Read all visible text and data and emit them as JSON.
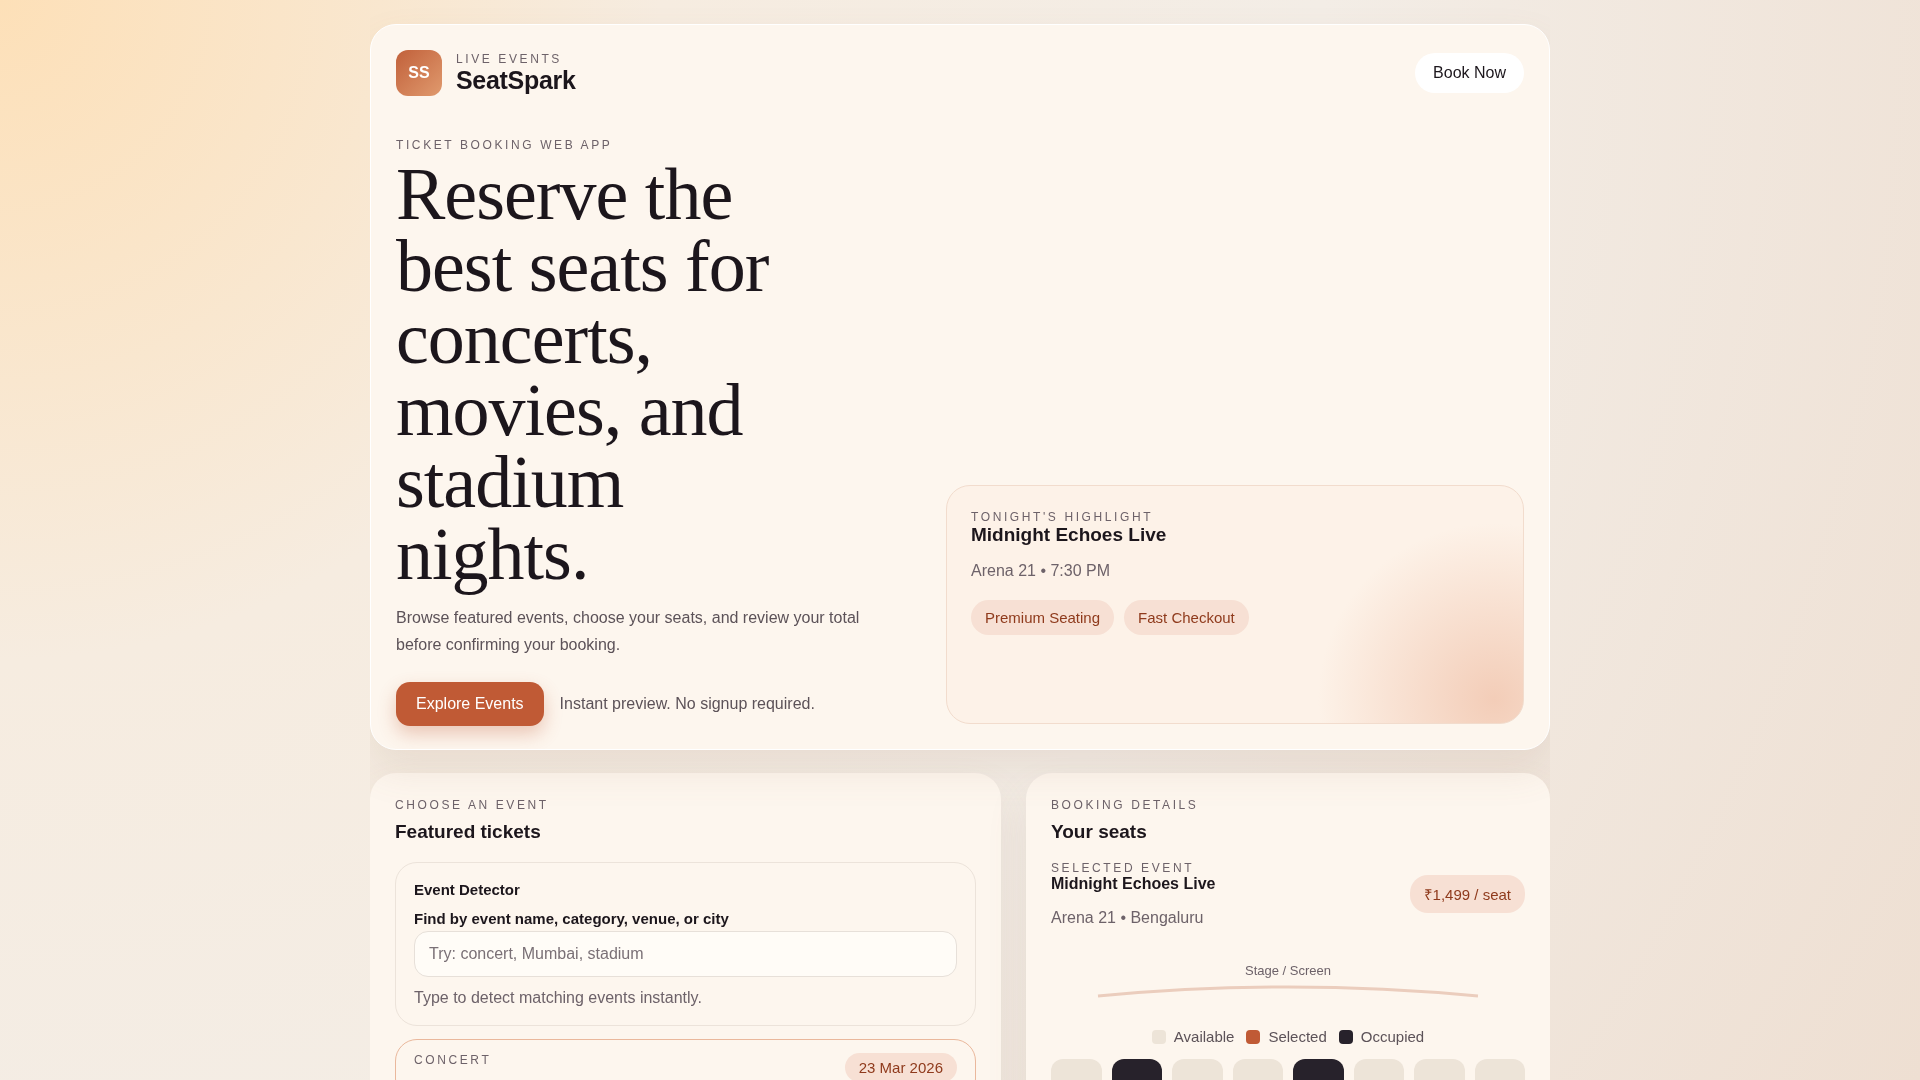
{
  "brand": {
    "logo": "SS",
    "eyebrow": "LIVE EVENTS",
    "name": "SeatSpark"
  },
  "header": {
    "cta": "Book Now"
  },
  "hero": {
    "eyebrow": "TICKET BOOKING WEB APP",
    "title": "Reserve the best seats for concerts, movies, and stadium nights.",
    "description": "Browse featured events, choose your seats, and review your total before confirming your booking.",
    "cta": "Explore Events",
    "note": "Instant preview. No signup required."
  },
  "highlight": {
    "eyebrow": "TONIGHT'S HIGHLIGHT",
    "title": "Midnight Echoes Live",
    "meta": "Arena 21 • 7:30 PM",
    "tags": [
      "Premium Seating",
      "Fast Checkout"
    ]
  },
  "events": {
    "eyebrow": "CHOOSE AN EVENT",
    "title": "Featured tickets",
    "detector": {
      "title": "Event Detector",
      "label": "Find by event name, category, venue, or city",
      "placeholder": "Try: concert, Mumbai, stadium",
      "hint": "Type to detect matching events instantly."
    },
    "cards": [
      {
        "category": "CONCERT",
        "date": "23 Mar 2026",
        "selected": true
      }
    ]
  },
  "booking": {
    "eyebrow": "BOOKING DETAILS",
    "title": "Your seats",
    "selected_label": "SELECTED EVENT",
    "event": "Midnight Echoes Live",
    "venue": "Arena 21 • Bengaluru",
    "price": "₹1,499 / seat",
    "stage": "Stage / Screen",
    "legend": [
      {
        "label": "Available",
        "color": "#ede4d8"
      },
      {
        "label": "Selected",
        "color": "#c05a35"
      },
      {
        "label": "Occupied",
        "color": "#27222b"
      }
    ],
    "seats": [
      {
        "kind": "available"
      },
      {
        "kind": "occupied"
      },
      {
        "kind": "available"
      },
      {
        "kind": "available"
      },
      {
        "kind": "occupied"
      },
      {
        "kind": "available"
      },
      {
        "kind": "available"
      },
      {
        "kind": "available"
      }
    ]
  }
}
